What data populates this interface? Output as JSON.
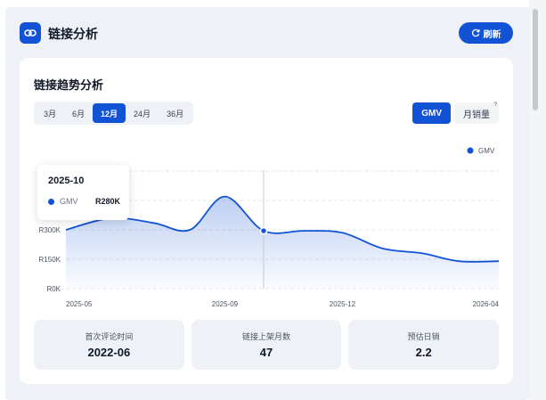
{
  "header": {
    "title": "链接分析",
    "refresh_label": "刷新",
    "icon": "link-icon",
    "refresh_icon": "refresh-icon"
  },
  "card": {
    "title": "链接趋势分析",
    "ranges": [
      "3月",
      "6月",
      "12月",
      "24月",
      "36月"
    ],
    "active_range": "12月",
    "metrics": [
      "GMV",
      "月销量"
    ],
    "active_metric": "GMV",
    "metric_help": "?"
  },
  "tooltip": {
    "title": "2025-10",
    "series": "GMV",
    "value": "R280K"
  },
  "chart_data": {
    "type": "area",
    "series": [
      {
        "name": "GMV",
        "color": "#1252d4",
        "points": [
          {
            "x": "2025-05-01",
            "y": 300
          },
          {
            "x": "2025-06-05",
            "y": 360
          },
          {
            "x": "2025-07-08",
            "y": 335
          },
          {
            "x": "2025-08-05",
            "y": 300
          },
          {
            "x": "2025-09-01",
            "y": 470
          },
          {
            "x": "2025-10-01",
            "y": 295
          },
          {
            "x": "2025-11-01",
            "y": 295
          },
          {
            "x": "2025-12-01",
            "y": 285
          },
          {
            "x": "2026-01-01",
            "y": 205
          },
          {
            "x": "2026-02-01",
            "y": 180
          },
          {
            "x": "2026-03-01",
            "y": 140
          },
          {
            "x": "2026-04-01",
            "y": 140
          }
        ]
      }
    ],
    "x_ticks": [
      "2025-05",
      "2025-09",
      "2025-12",
      "2026-04"
    ],
    "y_ticks": [
      "R0K",
      "R150K",
      "R300K",
      "R",
      "R"
    ],
    "ylim": [
      0,
      600
    ],
    "legend": "top-right",
    "hover_x": "2025-10-01",
    "grid": true
  },
  "stats": [
    {
      "label": "首次评论时间",
      "value": "2022-06"
    },
    {
      "label": "链接上架月数",
      "value": "47"
    },
    {
      "label": "预估日销",
      "value": "2.2"
    }
  ]
}
